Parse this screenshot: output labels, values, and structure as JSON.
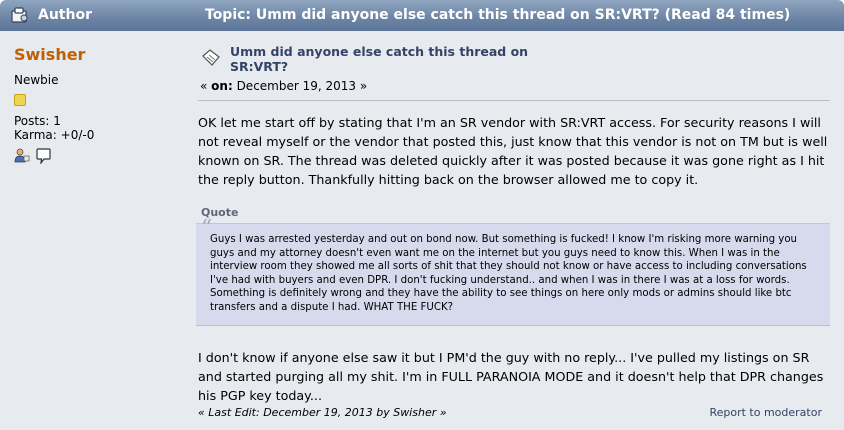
{
  "header": {
    "author_label": "Author",
    "topic_label": "Topic: Umm did anyone else catch this thread on SR:VRT?  (Read 84 times)"
  },
  "poster": {
    "name": "Swisher",
    "title": "Newbie",
    "posts": "Posts: 1",
    "karma": "Karma: +0/-0"
  },
  "post": {
    "subject_line1": "Umm did anyone else catch this thread on",
    "subject_line2": "SR:VRT?",
    "date_prefix": "« ",
    "date_on": "on:",
    "date_value": " December 19, 2013 »",
    "paragraph1": "OK let me start off by stating that I'm an SR vendor with SR:VRT access. For security reasons I will not reveal myself or the vendor that posted this, just know that this vendor is not on TM but is well known on SR. The thread was deleted quickly after it was posted because it was gone right as I hit the reply button. Thankfully hitting back on the browser allowed me to copy it.",
    "quote_label": "Quote",
    "quote_text": "Guys I was arrested yesterday and out on bond now. But something is fucked! I know I'm risking more warning you guys and my attorney doesn't even want me on the internet but you guys need to know this. When I was in the interview room they showed me all sorts of shit that they should not know or have access to including conversations I've had with buyers and even DPR. I don't fucking understand.. and when I was in there I was at a loss for words. Something is definitely wrong and they have the ability to see things on here only mods or admins should like btc transfers and a dispute I had. WHAT THE FUCK?",
    "paragraph2": "I don't know if anyone else saw it but I PM'd the guy with no reply... I've pulled my listings on SR and started purging all my shit. I'm in FULL PARANOIA MODE and it doesn't help that DPR changes his PGP key today...",
    "last_edit": "« Last Edit: December 19, 2013 by Swisher »",
    "report_link": "Report to moderator"
  },
  "colors": {
    "header_bg": "#6f87a6",
    "post_bg": "#e7eaef",
    "poster_name": "#c06002",
    "subject": "#334466",
    "quote_bg": "#d7daec"
  },
  "icons": {
    "header_icon": "author-icon",
    "subject_icon": "post-icon",
    "rank_icon": "star-icon",
    "profile_icon": "profile-icon",
    "message_icon": "message-icon"
  }
}
